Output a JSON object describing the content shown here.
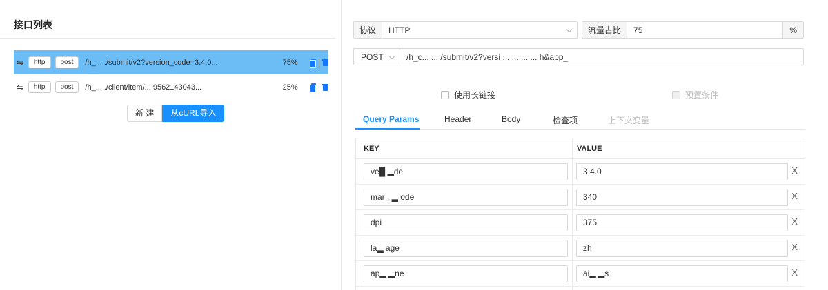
{
  "left_panel": {
    "title": "接口列表",
    "apis": [
      {
        "method_icon": "swap-icon",
        "protocol": "http",
        "method": "post",
        "path": "/h_  ..../submit/v2?version_code=3.4.0...",
        "percent": "75%",
        "selected": true
      },
      {
        "method_icon": "swap-icon",
        "protocol": "http",
        "method": "post",
        "path": "/h_...  ./client/item/... 9562143043...",
        "percent": "25%",
        "selected": false
      }
    ],
    "new_label": "新 建",
    "import_label": "从cURL导入"
  },
  "right_panel": {
    "protocol_label": "协议",
    "protocol_value": "HTTP",
    "traffic_label": "流量占比",
    "traffic_value": "75",
    "traffic_unit": "%",
    "method_value": "POST",
    "url_value": "/h_c...  ...  /submit/v2?versi   ...   ...   ...   ...   h&app_",
    "long_link_label": "使用长链接",
    "precondition_label": "预置条件",
    "tabs": [
      "Query Params",
      "Header",
      "Body",
      "检查项",
      "上下文变量"
    ],
    "table": {
      "key_header": "KEY",
      "value_header": "VALUE",
      "delete_symbol": "X",
      "rows": [
        {
          "key": "ve█ ▂de",
          "value": "3.4.0"
        },
        {
          "key": "mar    . ▂ ode",
          "value": "340"
        },
        {
          "key": "dpi",
          "value": "375"
        },
        {
          "key": "la▂ age",
          "value": "zh"
        },
        {
          "key": "ap▂ ▂ne",
          "value": "ai▂ ▂s"
        }
      ]
    }
  }
}
